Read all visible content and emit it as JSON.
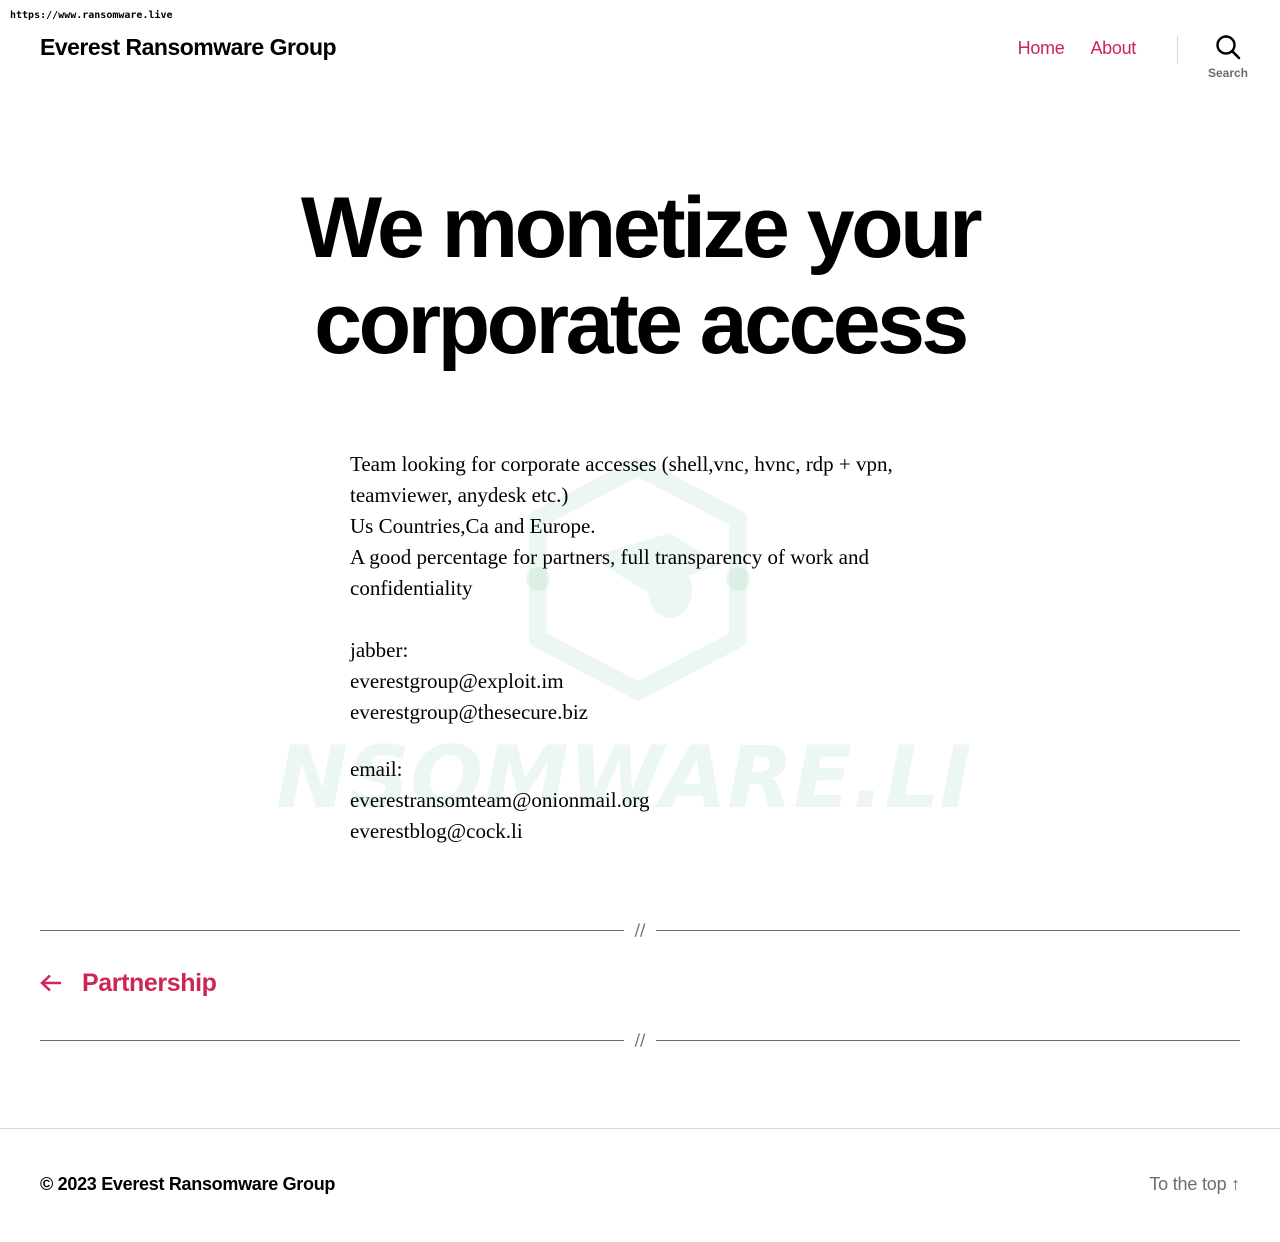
{
  "browser": {
    "url": "https://www.ransomware.live"
  },
  "header": {
    "site_title": "Everest Ransomware Group",
    "nav": [
      {
        "label": "Home"
      },
      {
        "label": "About"
      }
    ],
    "search_label": "Search"
  },
  "post": {
    "title": "We monetize your corporate access",
    "paragraphs": [
      "Team looking for corporate accesses (shell,vnc, hvnc, rdp + vpn, teamviewer, anydesk etc.)",
      "Us Countries,Ca and Europe.",
      "A good percentage for partners, full transparency of work and confidentiality"
    ],
    "jabber": {
      "label": "jabber:",
      "addresses": [
        "everestgroup@exploit.im",
        "everestgroup@thesecure.biz"
      ]
    },
    "email": {
      "label": "email:",
      "addresses": [
        "everestransomteam@onionmail.org",
        "everestblog@cock.li"
      ]
    }
  },
  "navigation": {
    "previous_label": "Partnership",
    "separator": "//"
  },
  "watermark": {
    "text": "RANSOMWARE.LIVE"
  },
  "footer": {
    "copyright": "© 2023 Everest Ransomware Group",
    "to_top": "To the top ↑"
  },
  "colors": {
    "accent": "#cd2653",
    "muted": "#6d6d6d",
    "watermark": "#1b9e5a"
  }
}
